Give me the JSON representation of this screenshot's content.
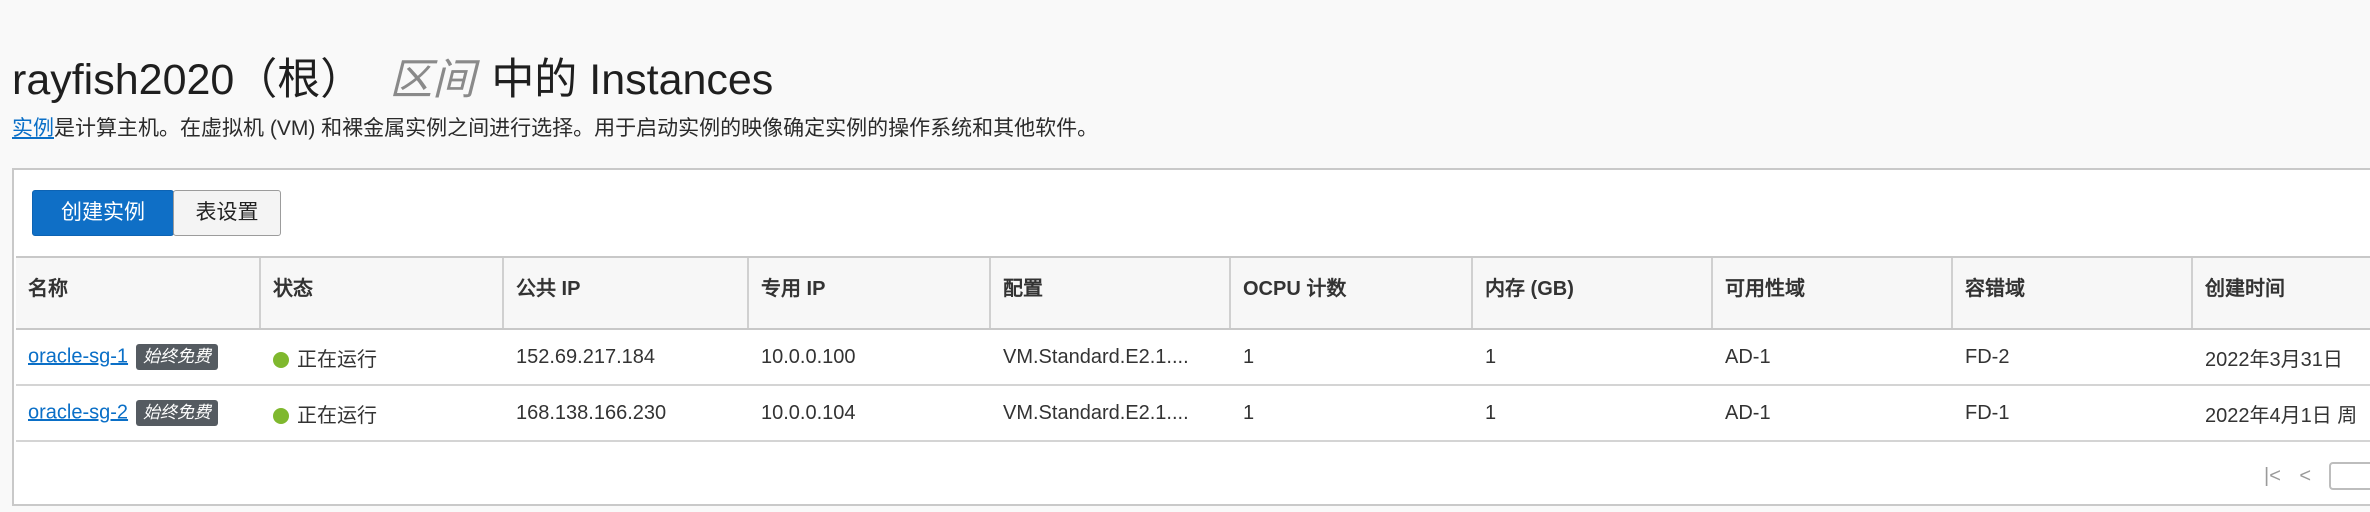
{
  "header": {
    "compartment": "rayfish2020（根）",
    "compartment_word": "区间",
    "title_rest": "中的 Instances"
  },
  "description": {
    "link_text": "实例",
    "text": "是计算主机。在虚拟机 (VM) 和裸金属实例之间进行选择。用于启动实例的映像确定实例的操作系统和其他软件。"
  },
  "toolbar": {
    "create_label": "创建实例",
    "settings_label": "表设置"
  },
  "table": {
    "columns": [
      "名称",
      "状态",
      "公共 IP",
      "专用 IP",
      "配置",
      "OCPU 计数",
      "内存 (GB)",
      "可用性域",
      "容错域",
      "创建时间"
    ],
    "rows": [
      {
        "name": "oracle-sg-1",
        "badge": "始终免费",
        "status": "正在运行",
        "public_ip": "152.69.217.184",
        "private_ip": "10.0.0.100",
        "shape": "VM.Standard.E2.1....",
        "ocpu": "1",
        "memory": "1",
        "ad": "AD-1",
        "fd": "FD-2",
        "created": "2022年3月31日"
      },
      {
        "name": "oracle-sg-2",
        "badge": "始终免费",
        "status": "正在运行",
        "public_ip": "168.138.166.230",
        "private_ip": "10.0.0.104",
        "shape": "VM.Standard.E2.1....",
        "ocpu": "1",
        "memory": "1",
        "ad": "AD-1",
        "fd": "FD-1",
        "created": "2022年4月1日 周"
      }
    ]
  },
  "pager": {
    "first_icon": "first-page-icon",
    "prev_icon": "previous-page-icon"
  },
  "colors": {
    "primary": "#0f6fc6",
    "running": "#7fb82e",
    "badge": "#555b61"
  }
}
